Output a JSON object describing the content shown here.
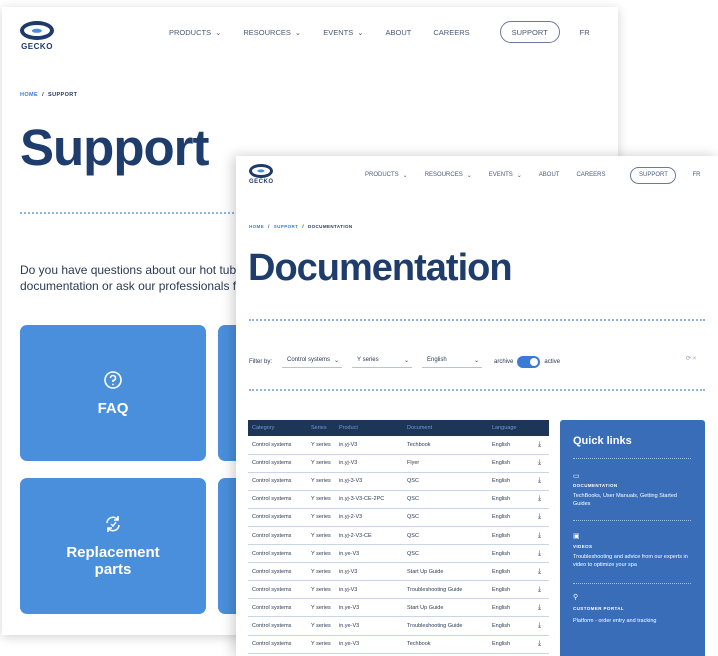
{
  "brand": {
    "name": "GECKO",
    "colors": {
      "navy": "#1d3557",
      "accent": "#4a8fdc",
      "quick_links_bg": "#3a6db8"
    }
  },
  "nav": {
    "items": [
      "PRODUCTS",
      "RESOURCES",
      "EVENTS",
      "ABOUT",
      "CAREERS"
    ],
    "support_label": "SUPPORT",
    "lang": "FR"
  },
  "support_page": {
    "breadcrumb": {
      "home": "HOME",
      "current": "SUPPORT"
    },
    "title": "Support",
    "intro_line1": "Do you have questions about our hot tub acc",
    "intro_line2": "documentation or ask our professionals for a",
    "tiles": [
      {
        "label": "FAQ",
        "icon": "question-circle-icon"
      },
      {
        "label": "Replacement parts",
        "icon": "refresh-cycle-icon"
      }
    ]
  },
  "documentation_page": {
    "breadcrumb": {
      "home": "HOME",
      "support": "SUPPORT",
      "current": "DOCUMENTATION"
    },
    "title": "Documentation",
    "filter": {
      "label": "Filter by:",
      "category": "Control systems",
      "series": "Y series",
      "language": "English",
      "archive_label": "archive",
      "active_label": "active",
      "toggle_state": "active"
    },
    "table": {
      "columns": [
        "Category",
        "Series",
        "Product",
        "Document",
        "Language"
      ],
      "rows": [
        [
          "Control systems",
          "Y series",
          "in.yj-V3",
          "Techbook",
          "English"
        ],
        [
          "Control systems",
          "Y series",
          "in.yj-V3",
          "Flyer",
          "English"
        ],
        [
          "Control systems",
          "Y series",
          "in.yj-3-V3",
          "QSC",
          "English"
        ],
        [
          "Control systems",
          "Y series",
          "in.yj-3-V3-CE-2PC",
          "QSC",
          "English"
        ],
        [
          "Control systems",
          "Y series",
          "in.yj-2-V3",
          "QSC",
          "English"
        ],
        [
          "Control systems",
          "Y series",
          "in.yj-2-V3-CE",
          "QSC",
          "English"
        ],
        [
          "Control systems",
          "Y series",
          "in.ye-V3",
          "QSC",
          "English"
        ],
        [
          "Control systems",
          "Y series",
          "in.yj-V3",
          "Start Up Guide",
          "English"
        ],
        [
          "Control systems",
          "Y series",
          "in.yj-V3",
          "Troubleshooting Guide",
          "English"
        ],
        [
          "Control systems",
          "Y series",
          "in.ye-V3",
          "Start Up Guide",
          "English"
        ],
        [
          "Control systems",
          "Y series",
          "in.ye-V3",
          "Troubleshooting Guide",
          "English"
        ],
        [
          "Control systems",
          "Y series",
          "in.ye-V3",
          "Techbook",
          "English"
        ]
      ]
    },
    "quick_links": {
      "title": "Quick links",
      "items": [
        {
          "icon": "document-icon",
          "heading": "DOCUMENTATION",
          "text": "TechBooks, User Manuals, Getting Started Guides"
        },
        {
          "icon": "video-icon",
          "heading": "VIDEOS",
          "text": "Troubleshooting and advice from our experts in video to optimize your spa"
        },
        {
          "icon": "user-icon",
          "heading": "CUSTOMER PORTAL",
          "text": "Platform - order entry and tracking"
        }
      ]
    }
  }
}
